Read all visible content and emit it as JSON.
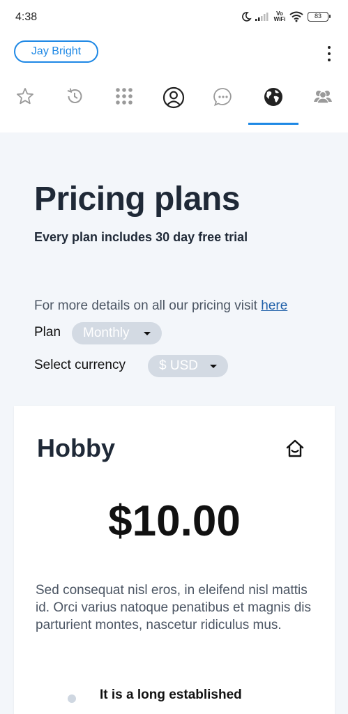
{
  "status_bar": {
    "time": "4:38",
    "network_label": "Vo WiFi",
    "battery": "83"
  },
  "header": {
    "user_name": "Jay Bright"
  },
  "tabs": [
    {
      "icon": "star-icon"
    },
    {
      "icon": "history-icon"
    },
    {
      "icon": "apps-grid-icon"
    },
    {
      "icon": "account-circle-icon"
    },
    {
      "icon": "chat-bubble-icon"
    },
    {
      "icon": "globe-icon",
      "selected": true
    },
    {
      "icon": "group-icon"
    }
  ],
  "colors": {
    "accent": "#1e88e5",
    "background": "#f3f6fa",
    "select_bg": "#d3dae3"
  },
  "pricing": {
    "title": "Pricing plans",
    "subtitle": "Every plan includes 30 day free trial",
    "details_text": "For more details on all our pricing visit ",
    "details_link": "here",
    "plan_label": "Plan",
    "plan_value": "Monthly",
    "currency_label": "Select currency",
    "currency_value": "$ USD"
  },
  "plan_card": {
    "name": "Hobby",
    "icon": "home-icon",
    "price": "$10.00",
    "description": "Sed consequat nisl eros, in eleifend nisl mattis id. Orci varius natoque penatibus et magnis dis parturient montes, nascetur ridiculus mus.",
    "features": [
      "It is a long established"
    ]
  }
}
